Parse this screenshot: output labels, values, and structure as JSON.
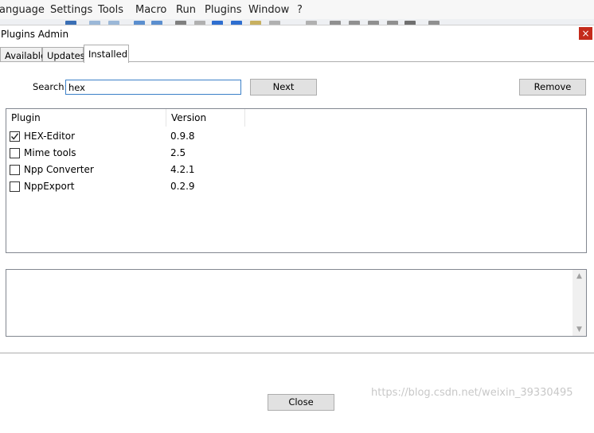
{
  "menubar": {
    "items": [
      {
        "label": "anguage"
      },
      {
        "label": "Settings"
      },
      {
        "label": "Tools"
      },
      {
        "label": "Macro"
      },
      {
        "label": "Run"
      },
      {
        "label": "Plugins"
      },
      {
        "label": "Window"
      },
      {
        "label": "?"
      }
    ]
  },
  "dialog": {
    "title": "Plugins Admin",
    "close_glyph": "×",
    "tabs": [
      {
        "label": "Available",
        "active": false
      },
      {
        "label": "Updates",
        "active": false
      },
      {
        "label": "Installed",
        "active": true
      }
    ],
    "search": {
      "label": "Search:",
      "value": "hex"
    },
    "next_label": "Next",
    "remove_label": "Remove",
    "list": {
      "columns": [
        "Plugin",
        "Version"
      ],
      "rows": [
        {
          "name": "HEX-Editor",
          "version": "0.9.8",
          "checked": true
        },
        {
          "name": "Mime tools",
          "version": "2.5",
          "checked": false
        },
        {
          "name": "Npp Converter",
          "version": "4.2.1",
          "checked": false
        },
        {
          "name": "NppExport",
          "version": "0.2.9",
          "checked": false
        }
      ]
    },
    "description": "",
    "close_label": "Close"
  },
  "watermark": "https://blog.csdn.net/weixin_39330495",
  "colors": {
    "accent": "#3c80c8",
    "close_red": "#c42b1c",
    "button_bg": "#e1e1e1"
  }
}
